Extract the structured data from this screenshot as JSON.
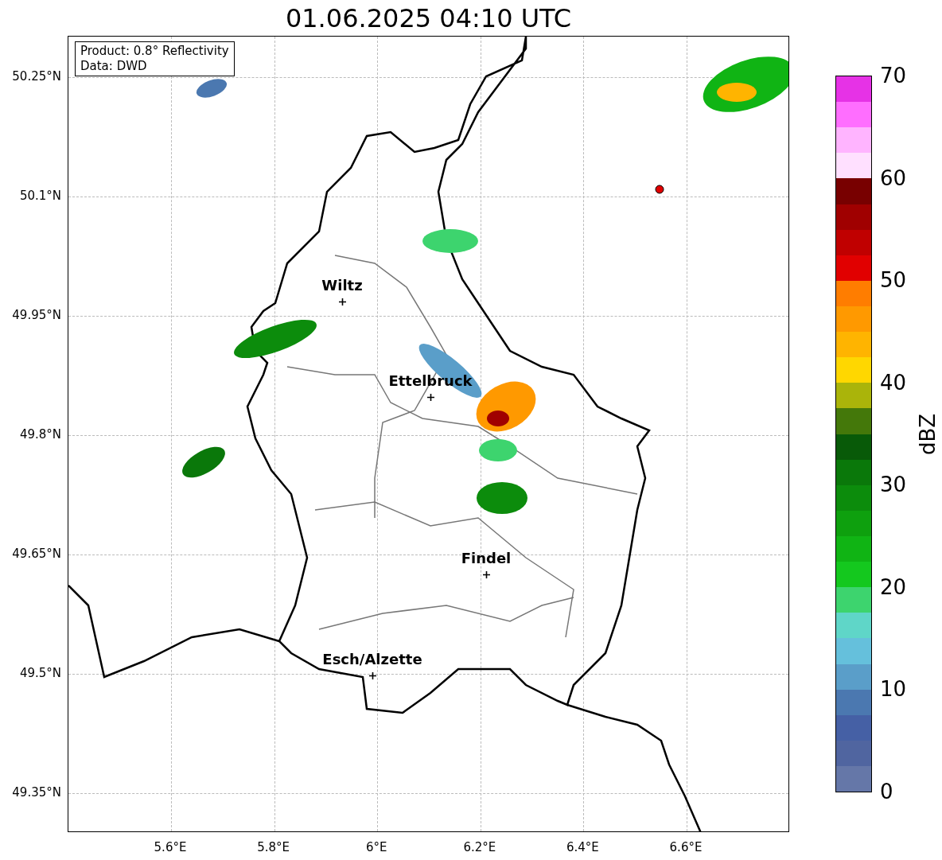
{
  "title": "01.06.2025 04:10 UTC",
  "legend": [
    "Product: 0.8° Reflectivity",
    "Data: DWD"
  ],
  "y_ticks": [
    "50.25°N",
    "50.1°N",
    "49.95°N",
    "49.8°N",
    "49.65°N",
    "49.5°N",
    "49.35°N"
  ],
  "x_ticks": [
    "5.6°E",
    "5.8°E",
    "6°E",
    "6.2°E",
    "6.4°E",
    "6.6°E"
  ],
  "cities": [
    {
      "name": "Wiltz"
    },
    {
      "name": "Ettelbruck"
    },
    {
      "name": "Findel"
    },
    {
      "name": "Esch/Alzette"
    }
  ],
  "colorbar": {
    "label": "dBZ",
    "ticks": [
      "70",
      "60",
      "50",
      "40",
      "30",
      "20",
      "10",
      "0"
    ],
    "segments": [
      {
        "color": "#6577a8"
      },
      {
        "color": "#5065a0"
      },
      {
        "color": "#4560a5"
      },
      {
        "color": "#4b78b0"
      },
      {
        "color": "#5a9ec9"
      },
      {
        "color": "#65c0dc"
      },
      {
        "color": "#5fd6c8"
      },
      {
        "color": "#3dd46e"
      },
      {
        "color": "#14c81e"
      },
      {
        "color": "#10b414"
      },
      {
        "color": "#0ea00e"
      },
      {
        "color": "#0c8c0c"
      },
      {
        "color": "#0a780a"
      },
      {
        "color": "#085a08"
      },
      {
        "color": "#44780a"
      },
      {
        "color": "#aab40a"
      },
      {
        "color": "#ffd700"
      },
      {
        "color": "#ffb400"
      },
      {
        "color": "#ff9900"
      },
      {
        "color": "#ff7d00"
      },
      {
        "color": "#e10000"
      },
      {
        "color": "#c00000"
      },
      {
        "color": "#a00000"
      },
      {
        "color": "#780000"
      },
      {
        "color": "#ffe0ff"
      },
      {
        "color": "#ffb4ff"
      },
      {
        "color": "#ff6eff"
      },
      {
        "color": "#e632e6"
      }
    ]
  }
}
